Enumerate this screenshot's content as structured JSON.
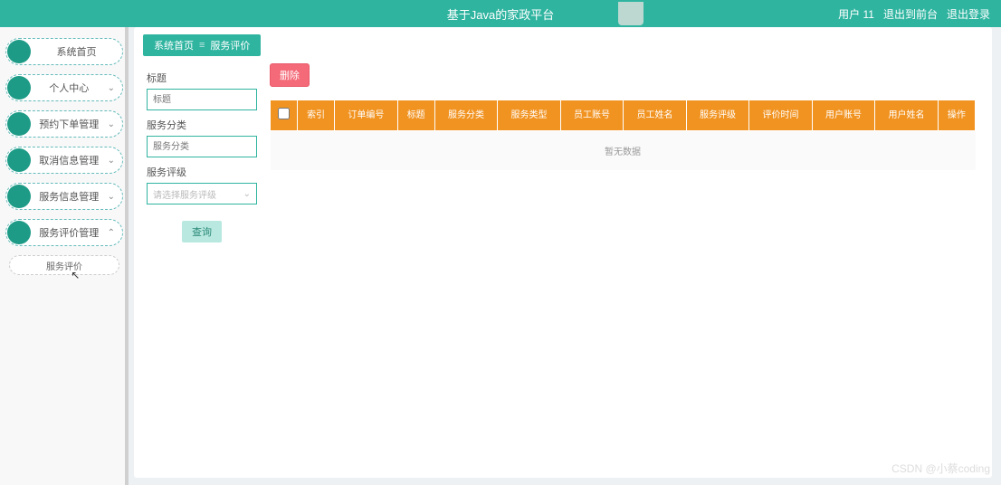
{
  "header": {
    "title": "基于Java的家政平台",
    "user": "用户 11",
    "to_front": "退出到前台",
    "logout": "退出登录"
  },
  "sidebar": {
    "items": [
      {
        "label": "系统首页",
        "has_caret": false
      },
      {
        "label": "个人中心",
        "has_caret": true
      },
      {
        "label": "预约下单管理",
        "has_caret": true
      },
      {
        "label": "取消信息管理",
        "has_caret": true
      },
      {
        "label": "服务信息管理",
        "has_caret": true
      },
      {
        "label": "服务评价管理",
        "has_caret": true,
        "open": true
      }
    ],
    "sub_item": "服务评价"
  },
  "breadcrumb": {
    "home": "系统首页",
    "current": "服务评价"
  },
  "search": {
    "title_label": "标题",
    "title_placeholder": "标题",
    "category_label": "服务分类",
    "category_placeholder": "服务分类",
    "rating_label": "服务评级",
    "rating_placeholder": "请选择服务评级",
    "btn": "查询"
  },
  "table": {
    "delete_btn": "删除",
    "headers": [
      "索引",
      "订单编号",
      "标题",
      "服务分类",
      "服务类型",
      "员工账号",
      "员工姓名",
      "服务评级",
      "评价时间",
      "用户账号",
      "用户姓名",
      "操作"
    ],
    "empty": "暂无数据"
  },
  "watermark": "CSDN @小蔡coding"
}
